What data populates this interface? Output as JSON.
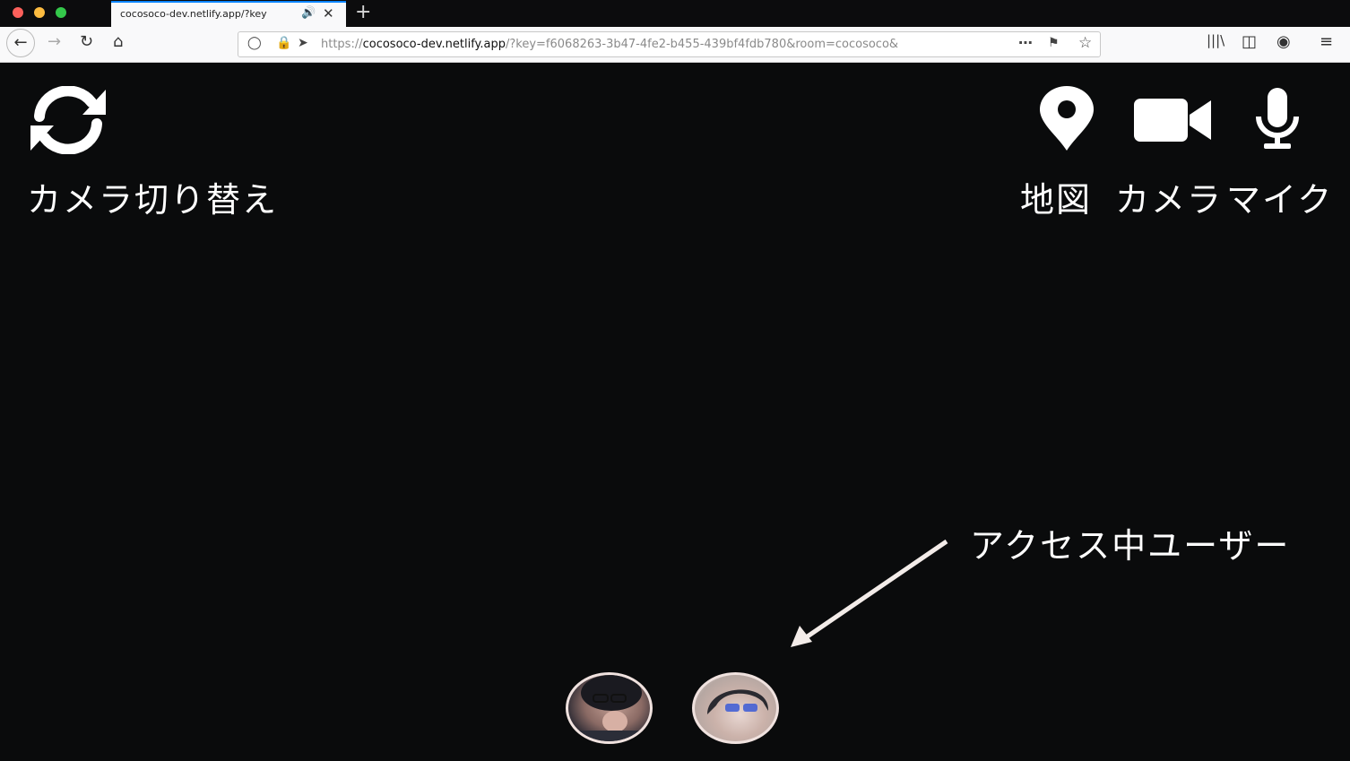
{
  "browser": {
    "tab_title": "cocosoco-dev.netlify.app/?key",
    "tab_sound_icon": "speaker-icon",
    "url_prefix": "https://",
    "url_host": "cocosoco-dev.netlify.app",
    "url_rest": "/?key=f6068263-3b47-4fe2-b455-439bf4fdb780&room=cocosoco&",
    "traffic_colors": [
      "#fc605b",
      "#fdbc40",
      "#34c84a"
    ],
    "accent": "#0a84ff"
  },
  "app": {
    "camera_switch_label": "カメラ切り替え",
    "map_label": "地図",
    "camera_label": "カメラ",
    "mic_label": "マイク",
    "active_users_label": "アクセス中ユーザー",
    "background": "#0a0b0c",
    "icon_color": "#ffffff"
  },
  "users": [
    {
      "icon": "user-avatar-1"
    },
    {
      "icon": "user-avatar-2"
    }
  ]
}
